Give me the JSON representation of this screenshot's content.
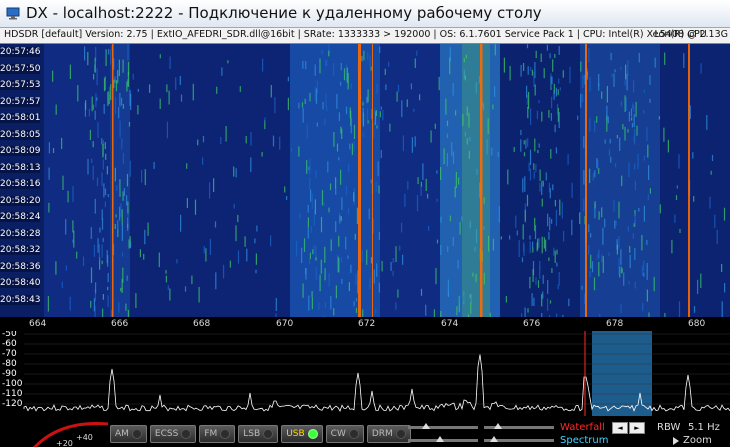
{
  "window": {
    "title": "DX - localhost:2222 - Подключение к удаленному рабочему столу"
  },
  "infobar": {
    "text": "HDSDR [default]  Version: 2.75  |  ExtIO_AFEDRI_SDR.dll@16bit  |  SRate: 1333333 > 192000  |  OS: 6.1.7601 Service Pack 1  |  CPU: Intel(R) Xeon(R) CPU",
    "right_text": "L5408 @ 2.13G"
  },
  "waterfall": {
    "timestamps": [
      "20:57:46",
      "20:57:50",
      "20:57:53",
      "20:57:57",
      "20:58:01",
      "20:58:05",
      "20:58:09",
      "20:58:13",
      "20:58:16",
      "20:58:20",
      "20:58:24",
      "20:58:28",
      "20:58:32",
      "20:58:36",
      "20:58:40",
      "20:58:43"
    ]
  },
  "freq_axis": {
    "ticks": [
      "664",
      "666",
      "668",
      "670",
      "672",
      "674",
      "676",
      "678",
      "680"
    ]
  },
  "spectrum": {
    "db_labels": [
      "-50",
      "-60",
      "-70",
      "-80",
      "-90",
      "-100",
      "-110",
      "-120"
    ]
  },
  "gauge": {
    "labels": [
      "+20",
      "+40"
    ]
  },
  "modes": [
    {
      "label": "AM",
      "active": false
    },
    {
      "label": "ECSS",
      "active": false
    },
    {
      "label": "FM",
      "active": false
    },
    {
      "label": "LSB",
      "active": false
    },
    {
      "label": "USB",
      "active": true
    },
    {
      "label": "CW",
      "active": false
    },
    {
      "label": "DRM",
      "active": false
    }
  ],
  "display_controls": {
    "waterfall_label": "Waterfall",
    "spectrum_label": "Spectrum",
    "prev_symbol": "◄",
    "next_symbol": "►",
    "rbw_label": "RBW",
    "rbw_value": "5.1 Hz",
    "zoom_label": "Zoom"
  },
  "colors": {
    "waterfall_bg": "#0a1e63",
    "signal_line": "#ff6a00",
    "spectrum_trace": "#ffffff",
    "passband": "#1d5d8e",
    "waterfall_label": "#ff2a2a",
    "spectrum_label": "#3fd6ff",
    "active_led": "#3cff3c"
  }
}
